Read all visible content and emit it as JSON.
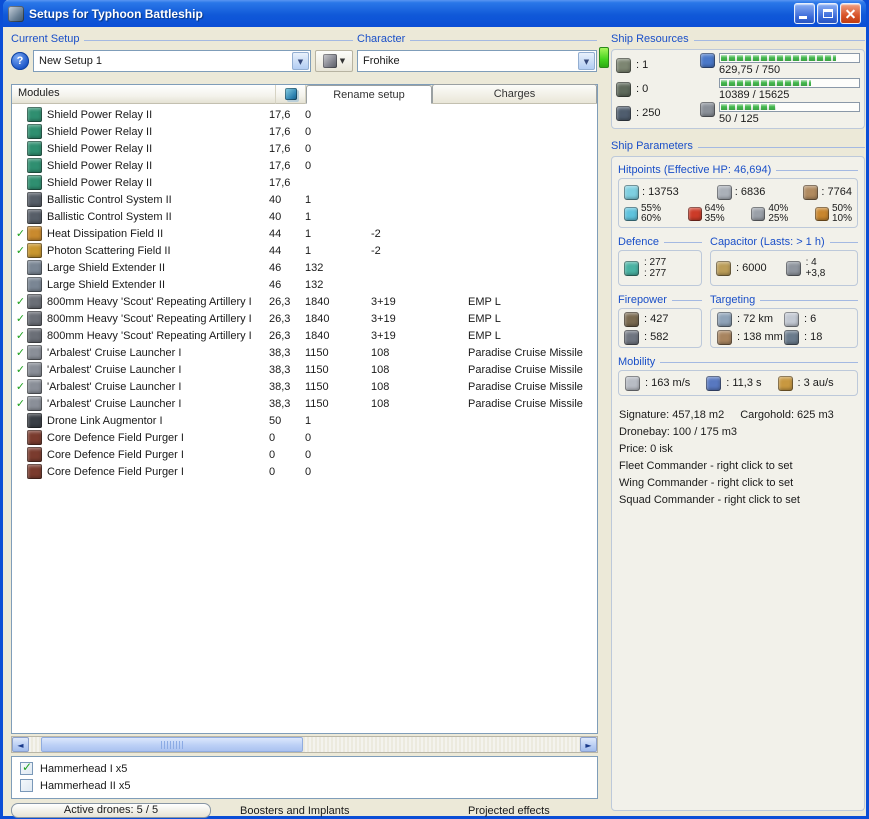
{
  "colors": {
    "titlebar_blue": "#1059d8",
    "caption_blue": "#1a4fc8",
    "bar_green": "#44b84e",
    "led_green": "#44d41e",
    "check_green": "#1fa120"
  },
  "window": {
    "title": "Setups for Typhoon Battleship"
  },
  "toolbar": {
    "current_setup_label": "Current Setup",
    "setup_value": "New Setup 1",
    "character_label": "Character",
    "character_value": "Frohike"
  },
  "modules_panel": {
    "header": "Modules",
    "tabs": [
      {
        "label": "Rename setup"
      },
      {
        "label": "Charges"
      }
    ],
    "rows": [
      {
        "active": false,
        "icon": "shield-power-relay-icon",
        "icon_color": "#2f8f70",
        "name": "Shield Power Relay II",
        "c1": "17,6",
        "c2": "0",
        "c3": "",
        "charge": ""
      },
      {
        "active": false,
        "icon": "shield-power-relay-icon",
        "icon_color": "#2f8f70",
        "name": "Shield Power Relay II",
        "c1": "17,6",
        "c2": "0",
        "c3": "",
        "charge": ""
      },
      {
        "active": false,
        "icon": "shield-power-relay-icon",
        "icon_color": "#2f8f70",
        "name": "Shield Power Relay II",
        "c1": "17,6",
        "c2": "0",
        "c3": "",
        "charge": ""
      },
      {
        "active": false,
        "icon": "shield-power-relay-icon",
        "icon_color": "#2f8f70",
        "name": "Shield Power Relay II",
        "c1": "17,6",
        "c2": "0",
        "c3": "",
        "charge": ""
      },
      {
        "active": false,
        "icon": "shield-power-relay-icon",
        "icon_color": "#2f8f70",
        "name": "Shield Power Relay II",
        "c1": "17,6",
        "c2": "",
        "c3": "",
        "charge": ""
      },
      {
        "active": false,
        "icon": "ballistic-control-icon",
        "icon_color": "#575e68",
        "name": "Ballistic Control System II",
        "c1": "40",
        "c2": "1",
        "c3": "",
        "charge": ""
      },
      {
        "active": false,
        "icon": "ballistic-control-icon",
        "icon_color": "#575e68",
        "name": "Ballistic Control System II",
        "c1": "40",
        "c2": "1",
        "c3": "",
        "charge": ""
      },
      {
        "active": true,
        "icon": "heat-dissipation-icon",
        "icon_color": "#c98a2e",
        "name": "Heat Dissipation Field II",
        "c1": "44",
        "c2": "1",
        "c3": "-2",
        "charge": ""
      },
      {
        "active": true,
        "icon": "photon-scattering-icon",
        "icon_color": "#c9972e",
        "name": "Photon Scattering Field II",
        "c1": "44",
        "c2": "1",
        "c3": "-2",
        "charge": ""
      },
      {
        "active": false,
        "icon": "shield-extender-icon",
        "icon_color": "#7a8694",
        "name": "Large Shield Extender II",
        "c1": "46",
        "c2": "132",
        "c3": "",
        "charge": ""
      },
      {
        "active": false,
        "icon": "shield-extender-icon",
        "icon_color": "#7a8694",
        "name": "Large Shield Extender II",
        "c1": "46",
        "c2": "132",
        "c3": "",
        "charge": ""
      },
      {
        "active": true,
        "icon": "artillery-icon",
        "icon_color": "#6b6f77",
        "name": "800mm Heavy 'Scout' Repeating Artillery I",
        "c1": "26,3",
        "c2": "1840",
        "c3": "3+19",
        "charge": "EMP L"
      },
      {
        "active": true,
        "icon": "artillery-icon",
        "icon_color": "#6b6f77",
        "name": "800mm Heavy 'Scout' Repeating Artillery I",
        "c1": "26,3",
        "c2": "1840",
        "c3": "3+19",
        "charge": "EMP L"
      },
      {
        "active": true,
        "icon": "artillery-icon",
        "icon_color": "#6b6f77",
        "name": "800mm Heavy 'Scout' Repeating Artillery I",
        "c1": "26,3",
        "c2": "1840",
        "c3": "3+19",
        "charge": "EMP L"
      },
      {
        "active": true,
        "icon": "cruise-launcher-icon",
        "icon_color": "#8a8f98",
        "name": "'Arbalest' Cruise Launcher I",
        "c1": "38,3",
        "c2": "1150",
        "c3": "108",
        "charge": "Paradise Cruise Missile"
      },
      {
        "active": true,
        "icon": "cruise-launcher-icon",
        "icon_color": "#8a8f98",
        "name": "'Arbalest' Cruise Launcher I",
        "c1": "38,3",
        "c2": "1150",
        "c3": "108",
        "charge": "Paradise Cruise Missile"
      },
      {
        "active": true,
        "icon": "cruise-launcher-icon",
        "icon_color": "#8a8f98",
        "name": "'Arbalest' Cruise Launcher I",
        "c1": "38,3",
        "c2": "1150",
        "c3": "108",
        "charge": "Paradise Cruise Missile"
      },
      {
        "active": true,
        "icon": "cruise-launcher-icon",
        "icon_color": "#8a8f98",
        "name": "'Arbalest' Cruise Launcher I",
        "c1": "38,3",
        "c2": "1150",
        "c3": "108",
        "charge": "Paradise Cruise Missile"
      },
      {
        "active": false,
        "icon": "drone-link-icon",
        "icon_color": "#3a3f46",
        "name": "Drone Link Augmentor I",
        "c1": "50",
        "c2": "1",
        "c3": "",
        "charge": ""
      },
      {
        "active": false,
        "icon": "rig-purger-icon",
        "icon_color": "#7a3b2e",
        "name": "Core Defence Field Purger I",
        "c1": "0",
        "c2": "0",
        "c3": "",
        "charge": ""
      },
      {
        "active": false,
        "icon": "rig-purger-icon",
        "icon_color": "#7a3b2e",
        "name": "Core Defence Field Purger I",
        "c1": "0",
        "c2": "0",
        "c3": "",
        "charge": ""
      },
      {
        "active": false,
        "icon": "rig-purger-icon",
        "icon_color": "#7a3b2e",
        "name": "Core Defence Field Purger I",
        "c1": "0",
        "c2": "0",
        "c3": "",
        "charge": ""
      }
    ]
  },
  "drones": {
    "items": [
      {
        "checked": true,
        "label": "Hammerhead I x5"
      },
      {
        "checked": false,
        "label": "Hammerhead II x5"
      }
    ]
  },
  "bottom": {
    "active_drones": "Active drones: 5 / 5",
    "boosters": "Boosters and Implants",
    "projected": "Projected effects"
  },
  "ship_resources": {
    "title": "Ship Resources",
    "slots": [
      {
        "icon": "turret-hardpoints-icon",
        "icon_color": "#7d8672",
        "value": ": 1"
      },
      {
        "icon": "launcher-hardpoints-icon",
        "icon_color": "#5f6a5c",
        "value": ": 0"
      },
      {
        "icon": "drone-capacity-icon",
        "icon_color": "#4f5d6e",
        "value": ": 250"
      }
    ],
    "bars": [
      {
        "icon": "cargo-icon",
        "icon_color": "#4a78c8",
        "label": "629,75 / 750",
        "fill": "84%"
      },
      {
        "label": "10389 / 15625",
        "fill": "66%"
      },
      {
        "icon": "rig-calibration-icon",
        "icon_color": "#8a9098",
        "label": "50 / 125",
        "fill": "40%"
      }
    ]
  },
  "ship_parameters": {
    "title": "Ship Parameters",
    "hitpoints": {
      "title": "Hitpoints (Effective HP: 46,694)",
      "hp": [
        {
          "icon": "shield-hp-icon",
          "color": "#7ecfe0",
          "value": ": 13753"
        },
        {
          "icon": "armor-hp-icon",
          "color": "#aab0b8",
          "value": ": 6836"
        },
        {
          "icon": "structure-hp-icon",
          "color": "#b08a5f",
          "value": ": 7764"
        }
      ],
      "resists": [
        {
          "icon": "em-resist-icon",
          "color": "#5fc3dd",
          "top": "55%",
          "bottom": "60%"
        },
        {
          "icon": "thermal-resist-icon",
          "color": "#cc3b28",
          "top": "64%",
          "bottom": "35%"
        },
        {
          "icon": "kinetic-resist-icon",
          "color": "#9aa0a8",
          "top": "40%",
          "bottom": "25%"
        },
        {
          "icon": "explosive-resist-icon",
          "color": "#c8862e",
          "top": "50%",
          "bottom": "10%"
        }
      ]
    },
    "defence": {
      "title": "Defence",
      "values": [
        ": 277",
        ": 277"
      ]
    },
    "capacitor": {
      "title": "Capacitor (Lasts: > 1 h)",
      "cap_value": ": 6000",
      "recharge_value": ": 4",
      "recharge_delta": "+3,8"
    },
    "firepower": {
      "title": "Firepower",
      "items": [
        {
          "icon": "turret-firepower-icon",
          "color": "#7a6a50",
          "value": ": 427"
        },
        {
          "icon": "missile-firepower-icon",
          "color": "#6f7580",
          "value": ": 582"
        }
      ]
    },
    "targeting": {
      "title": "Targeting",
      "cells": [
        {
          "icon": "targeting-range-icon",
          "color": "#8fa3b8",
          "value": ": 72 km"
        },
        {
          "icon": "max-targets-icon",
          "color": "#c2c8d2",
          "value": ": 6"
        },
        {
          "icon": "scan-resolution-icon",
          "color": "#a8845f",
          "value": ": 138 mm"
        },
        {
          "icon": "sensor-strength-icon",
          "color": "#6a7b8c",
          "value": ": 18"
        }
      ]
    },
    "mobility": {
      "title": "Mobility",
      "items": [
        {
          "icon": "max-velocity-icon",
          "color": "#b8bcc4",
          "value": ": 163 m/s"
        },
        {
          "icon": "align-time-icon",
          "color": "#5878c0",
          "value": ": 11,3 s"
        },
        {
          "icon": "warp-speed-icon",
          "color": "#c89840",
          "value": ": 3 au/s"
        }
      ]
    },
    "info": {
      "signature": "Signature: 457,18 m2",
      "cargohold": "Cargohold: 625 m3",
      "dronebay": "Dronebay: 100 / 175 m3",
      "price": "Price: 0 isk",
      "fleet": "Fleet Commander - right click to set",
      "wing": "Wing Commander - right click to set",
      "squad": "Squad Commander - right click to set"
    }
  }
}
